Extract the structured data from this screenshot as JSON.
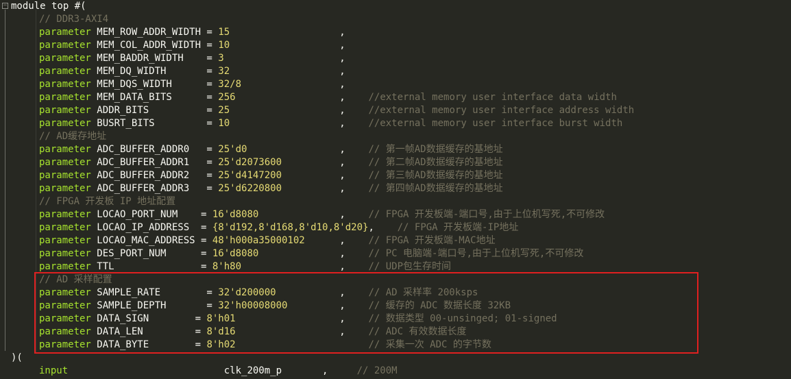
{
  "editor": {
    "lines": [
      {
        "indent": false,
        "tokens": [
          {
            "t": "module top #(",
            "c": "plain"
          }
        ]
      },
      {
        "indent": true,
        "tokens": [
          {
            "t": "// DDR3-AXI4",
            "c": "comment"
          }
        ]
      },
      {
        "indent": true,
        "tokens": [
          {
            "t": "parameter",
            "c": "keyword"
          },
          {
            "t": " MEM_ROW_ADDR_WIDTH = ",
            "c": "name"
          },
          {
            "t": "15",
            "c": "number"
          },
          {
            "t": "                   ,",
            "c": "plain"
          }
        ]
      },
      {
        "indent": true,
        "tokens": [
          {
            "t": "parameter",
            "c": "keyword"
          },
          {
            "t": " MEM_COL_ADDR_WIDTH = ",
            "c": "name"
          },
          {
            "t": "10",
            "c": "number"
          },
          {
            "t": "                   ,",
            "c": "plain"
          }
        ]
      },
      {
        "indent": true,
        "tokens": [
          {
            "t": "parameter",
            "c": "keyword"
          },
          {
            "t": " MEM_BADDR_WIDTH    = ",
            "c": "name"
          },
          {
            "t": "3",
            "c": "number"
          },
          {
            "t": "                    ,",
            "c": "plain"
          }
        ]
      },
      {
        "indent": true,
        "tokens": [
          {
            "t": "parameter",
            "c": "keyword"
          },
          {
            "t": " MEM_DQ_WIDTH       = ",
            "c": "name"
          },
          {
            "t": "32",
            "c": "number"
          },
          {
            "t": "                   ,",
            "c": "plain"
          }
        ]
      },
      {
        "indent": true,
        "tokens": [
          {
            "t": "parameter",
            "c": "keyword"
          },
          {
            "t": " MEM_DQS_WIDTH      = ",
            "c": "name"
          },
          {
            "t": "32/8",
            "c": "number"
          },
          {
            "t": "                 ,",
            "c": "plain"
          }
        ]
      },
      {
        "indent": true,
        "tokens": [
          {
            "t": "parameter",
            "c": "keyword"
          },
          {
            "t": " MEM_DATA_BITS      = ",
            "c": "name"
          },
          {
            "t": "256",
            "c": "number"
          },
          {
            "t": "                  ,    ",
            "c": "plain"
          },
          {
            "t": "//external memory user interface data width",
            "c": "comment"
          }
        ]
      },
      {
        "indent": true,
        "tokens": [
          {
            "t": "parameter",
            "c": "keyword"
          },
          {
            "t": " ADDR_BITS          = ",
            "c": "name"
          },
          {
            "t": "25",
            "c": "number"
          },
          {
            "t": "                   ,    ",
            "c": "plain"
          },
          {
            "t": "//external memory user interface address width",
            "c": "comment"
          }
        ]
      },
      {
        "indent": true,
        "tokens": [
          {
            "t": "parameter",
            "c": "keyword"
          },
          {
            "t": " BUSRT_BITS         = ",
            "c": "name"
          },
          {
            "t": "10",
            "c": "number"
          },
          {
            "t": "                   ,    ",
            "c": "plain"
          },
          {
            "t": "//external memory user interface burst width",
            "c": "comment"
          }
        ]
      },
      {
        "indent": true,
        "tokens": [
          {
            "t": "// AD缓存地址",
            "c": "comment"
          }
        ]
      },
      {
        "indent": true,
        "tokens": [
          {
            "t": "parameter",
            "c": "keyword"
          },
          {
            "t": " ADC_BUFFER_ADDR0   = ",
            "c": "name"
          },
          {
            "t": "25'd0",
            "c": "number"
          },
          {
            "t": "                ,    ",
            "c": "plain"
          },
          {
            "t": "// 第一帧AD数据缓存的基地址",
            "c": "comment"
          }
        ]
      },
      {
        "indent": true,
        "tokens": [
          {
            "t": "parameter",
            "c": "keyword"
          },
          {
            "t": " ADC_BUFFER_ADDR1   = ",
            "c": "name"
          },
          {
            "t": "25'd2073600",
            "c": "number"
          },
          {
            "t": "          ,    ",
            "c": "plain"
          },
          {
            "t": "// 第二帧AD数据缓存的基地址",
            "c": "comment"
          }
        ]
      },
      {
        "indent": true,
        "tokens": [
          {
            "t": "parameter",
            "c": "keyword"
          },
          {
            "t": " ADC_BUFFER_ADDR2   = ",
            "c": "name"
          },
          {
            "t": "25'd4147200",
            "c": "number"
          },
          {
            "t": "          ,    ",
            "c": "plain"
          },
          {
            "t": "// 第三帧AD数据缓存的基地址",
            "c": "comment"
          }
        ]
      },
      {
        "indent": true,
        "tokens": [
          {
            "t": "parameter",
            "c": "keyword"
          },
          {
            "t": " ADC_BUFFER_ADDR3   = ",
            "c": "name"
          },
          {
            "t": "25'd6220800",
            "c": "number"
          },
          {
            "t": "          ,    ",
            "c": "plain"
          },
          {
            "t": "// 第四帧AD数据缓存的基地址",
            "c": "comment"
          }
        ]
      },
      {
        "indent": true,
        "tokens": [
          {
            "t": "// FPGA 开发板 IP 地址配置",
            "c": "comment"
          }
        ]
      },
      {
        "indent": true,
        "tokens": [
          {
            "t": "parameter",
            "c": "keyword"
          },
          {
            "t": " LOCAO_PORT_NUM    = ",
            "c": "name"
          },
          {
            "t": "16'd8080",
            "c": "number"
          },
          {
            "t": "              ,    ",
            "c": "plain"
          },
          {
            "t": "// FPGA 开发板端-端口号,由于上位机写死,不可修改",
            "c": "comment"
          }
        ]
      },
      {
        "indent": true,
        "tokens": [
          {
            "t": "parameter",
            "c": "keyword"
          },
          {
            "t": " LOCAO_IP_ADDRESS  = ",
            "c": "name"
          },
          {
            "t": "{8'd192,8'd168,8'd10,8'd20}",
            "c": "number"
          },
          {
            "t": ",    ",
            "c": "plain"
          },
          {
            "t": "// FPGA 开发板端-IP地址",
            "c": "comment"
          }
        ]
      },
      {
        "indent": true,
        "tokens": [
          {
            "t": "parameter",
            "c": "keyword"
          },
          {
            "t": " LOCAO_MAC_ADDRESS = ",
            "c": "name"
          },
          {
            "t": "48'h000a35000102",
            "c": "number"
          },
          {
            "t": "      ,    ",
            "c": "plain"
          },
          {
            "t": "// FPGA 开发板端-MAC地址",
            "c": "comment"
          }
        ]
      },
      {
        "indent": true,
        "tokens": [
          {
            "t": "parameter",
            "c": "keyword"
          },
          {
            "t": " DES_PORT_NUM      = ",
            "c": "name"
          },
          {
            "t": "16'd8080",
            "c": "number"
          },
          {
            "t": "              ,    ",
            "c": "plain"
          },
          {
            "t": "// PC 电脑端-端口号,由于上位机写死,不可修改",
            "c": "comment"
          }
        ]
      },
      {
        "indent": true,
        "tokens": [
          {
            "t": "parameter",
            "c": "keyword"
          },
          {
            "t": " TTL               = ",
            "c": "name"
          },
          {
            "t": "8'h80",
            "c": "number"
          },
          {
            "t": "                 ,    ",
            "c": "plain"
          },
          {
            "t": "// UDP包生存时间",
            "c": "comment"
          }
        ]
      },
      {
        "indent": true,
        "tokens": [
          {
            "t": "// AD 采样配置",
            "c": "comment"
          }
        ]
      },
      {
        "indent": true,
        "tokens": [
          {
            "t": "parameter",
            "c": "keyword"
          },
          {
            "t": " SAMPLE_RATE        = ",
            "c": "name"
          },
          {
            "t": "32'd200000",
            "c": "number"
          },
          {
            "t": "           ,    ",
            "c": "plain"
          },
          {
            "t": "// AD 采样率 200ksps",
            "c": "comment"
          }
        ]
      },
      {
        "indent": true,
        "tokens": [
          {
            "t": "parameter",
            "c": "keyword"
          },
          {
            "t": " SAMPLE_DEPTH       = ",
            "c": "name"
          },
          {
            "t": "32'h00008000",
            "c": "number"
          },
          {
            "t": "         ,    ",
            "c": "plain"
          },
          {
            "t": "// 缓存的 ADC 数据长度 32KB",
            "c": "comment"
          }
        ]
      },
      {
        "indent": true,
        "tokens": [
          {
            "t": "parameter",
            "c": "keyword"
          },
          {
            "t": " DATA_SIGN        = ",
            "c": "name"
          },
          {
            "t": "8'h01",
            "c": "number"
          },
          {
            "t": "                  ,    ",
            "c": "plain"
          },
          {
            "t": "// 数据类型 00-unsinged; 01-signed",
            "c": "comment"
          }
        ]
      },
      {
        "indent": true,
        "tokens": [
          {
            "t": "parameter",
            "c": "keyword"
          },
          {
            "t": " DATA_LEN         = ",
            "c": "name"
          },
          {
            "t": "8'd16",
            "c": "number"
          },
          {
            "t": "                  ,    ",
            "c": "plain"
          },
          {
            "t": "// ADC 有效数据长度",
            "c": "comment"
          }
        ]
      },
      {
        "indent": true,
        "tokens": [
          {
            "t": "parameter",
            "c": "keyword"
          },
          {
            "t": " DATA_BYTE        = ",
            "c": "name"
          },
          {
            "t": "8'h02",
            "c": "number"
          },
          {
            "t": "                       ",
            "c": "plain"
          },
          {
            "t": "// 采集一次 ADC 的字节数",
            "c": "comment"
          }
        ]
      },
      {
        "indent": false,
        "tokens": [
          {
            "t": ")(",
            "c": "plain"
          }
        ]
      },
      {
        "indent": true,
        "tokens": [
          {
            "t": "input",
            "c": "keyword"
          },
          {
            "t": "                           clk_200m_p       ,     ",
            "c": "name"
          },
          {
            "t": "// 200M",
            "c": "comment"
          }
        ]
      }
    ],
    "fold_symbol": "−",
    "highlight_color": "#e02020"
  }
}
